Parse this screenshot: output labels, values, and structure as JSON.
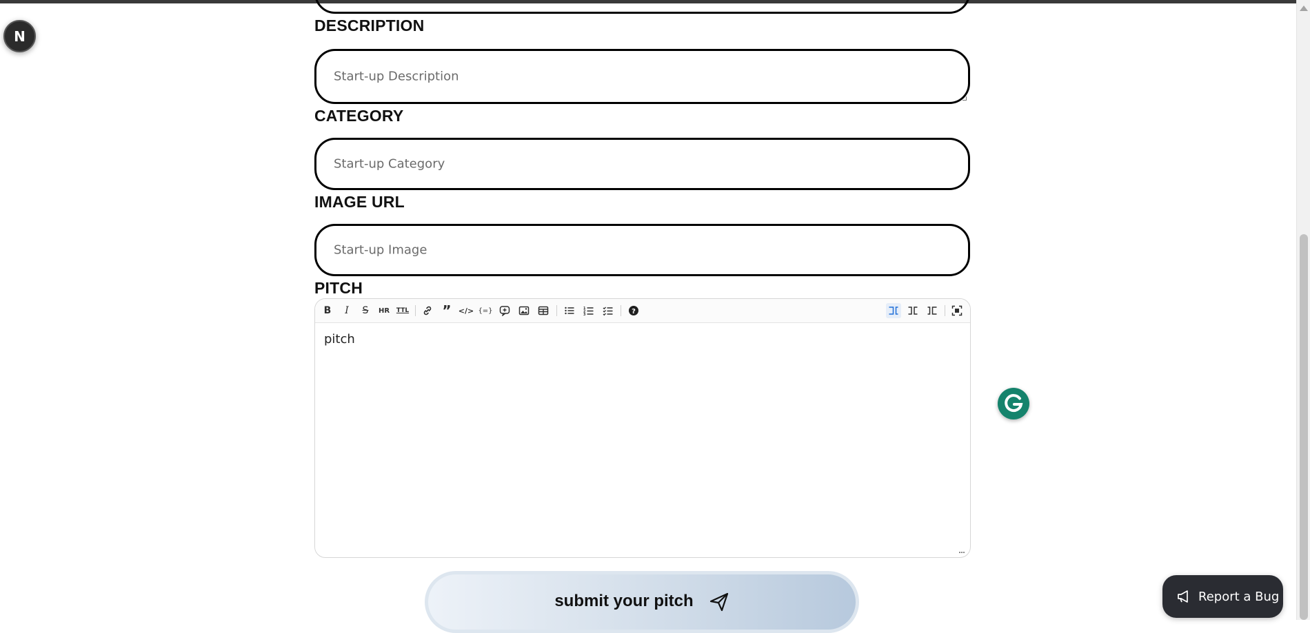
{
  "app": {
    "badge_letter": "N"
  },
  "form": {
    "description": {
      "label": "DESCRIPTION",
      "placeholder": "Start-up Description"
    },
    "category": {
      "label": "CATEGORY",
      "placeholder": "Start-up Category"
    },
    "image_url": {
      "label": "IMAGE URL",
      "placeholder": "Start-up Image"
    },
    "pitch": {
      "label": "PITCH",
      "content": "pitch",
      "toolbar": {
        "left_icons": [
          "bold-icon",
          "italic-icon",
          "strikethrough-icon",
          "hr-icon",
          "title-icon",
          "link-icon",
          "quote-icon",
          "code-icon",
          "code-block-icon",
          "comment-icon",
          "image-icon",
          "table-icon",
          "unordered-list-icon",
          "ordered-list-icon",
          "checked-list-icon",
          "help-icon"
        ],
        "right_icons": [
          "edit-mode-icon",
          "live-mode-icon",
          "preview-mode-icon",
          "fullscreen-icon"
        ],
        "active_mode": "edit-mode-icon"
      }
    },
    "submit_label": "submit your pitch"
  },
  "widgets": {
    "report_bug_label": "Report a Bug",
    "grammarly_letter": "G"
  },
  "colors": {
    "accent": "#1e6ed8",
    "grammarly": "#15836c",
    "report_bg": "#2a2c32"
  }
}
